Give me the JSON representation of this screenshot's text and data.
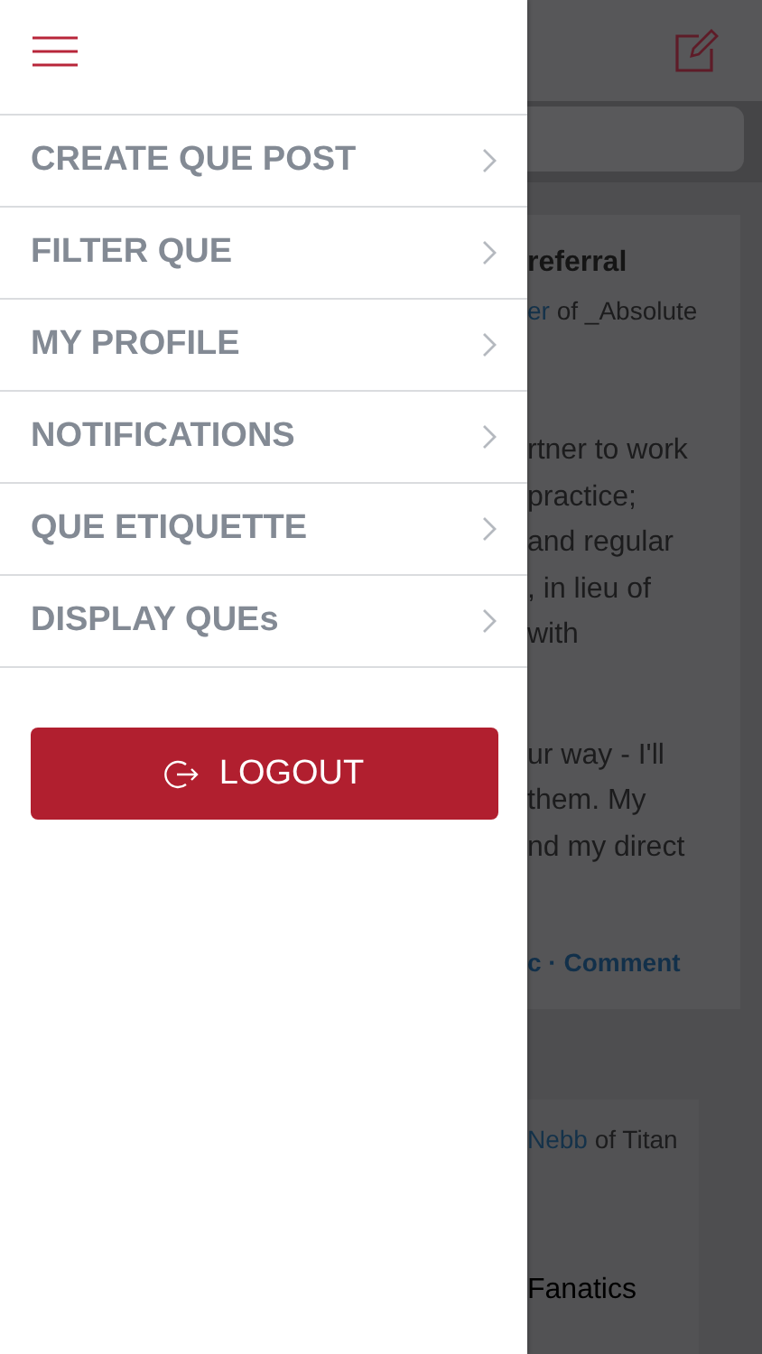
{
  "menu": {
    "items": [
      {
        "label": "CREATE QUE POST"
      },
      {
        "label": "FILTER QUE"
      },
      {
        "label": "MY PROFILE"
      },
      {
        "label": "NOTIFICATIONS"
      },
      {
        "label": "QUE ETIQUETTE"
      },
      {
        "label": "DISPLAY QUEs"
      }
    ],
    "logout": "LOGOUT"
  },
  "feed": {
    "posts": [
      {
        "title": "referral",
        "author_link": "er",
        "author_rest": "of _Absolute",
        "body_lines": [
          "rtner to work",
          " practice;",
          "and regular",
          ", in lieu of",
          "with"
        ],
        "body_lines_2": [
          "ur way - I'll",
          "them. My",
          "nd my direct"
        ],
        "actions": "c · Comment"
      },
      {
        "author_link": "Nebb",
        "author_rest": "of Titan",
        "text": "Fanatics"
      }
    ]
  }
}
